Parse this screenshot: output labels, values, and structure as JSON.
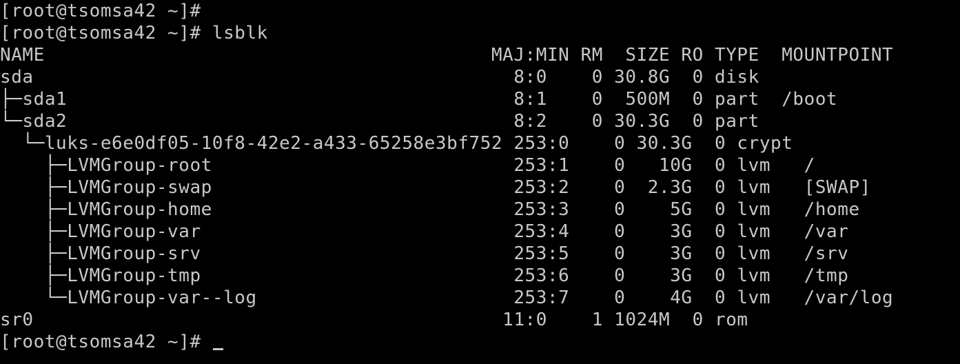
{
  "terminal": {
    "lines": [
      "[root@tsomsa42 ~]#",
      "[root@tsomsa42 ~]# lsblk",
      "NAME                                        MAJ:MIN RM  SIZE RO TYPE  MOUNTPOINT",
      "sda                                           8:0    0 30.8G  0 disk",
      "├─sda1                                        8:1    0  500M  0 part  /boot",
      "└─sda2                                        8:2    0 30.3G  0 part",
      "  └─luks-e6e0df05-10f8-42e2-a433-65258e3bf752 253:0    0 30.3G  0 crypt",
      "    ├─LVMGroup-root                           253:1    0   10G  0 lvm   /",
      "    ├─LVMGroup-swap                           253:2    0  2.3G  0 lvm   [SWAP]",
      "    ├─LVMGroup-home                           253:3    0    5G  0 lvm   /home",
      "    ├─LVMGroup-var                            253:4    0    3G  0 lvm   /var",
      "    ├─LVMGroup-srv                            253:5    0    3G  0 lvm   /srv",
      "    ├─LVMGroup-tmp                            253:6    0    3G  0 lvm   /tmp",
      "    └─LVMGroup-var--log                       253:7    0    4G  0 lvm   /var/log",
      "sr0                                          11:0    1 1024M  0 rom"
    ],
    "prompt": "[root@tsomsa42 ~]# "
  }
}
